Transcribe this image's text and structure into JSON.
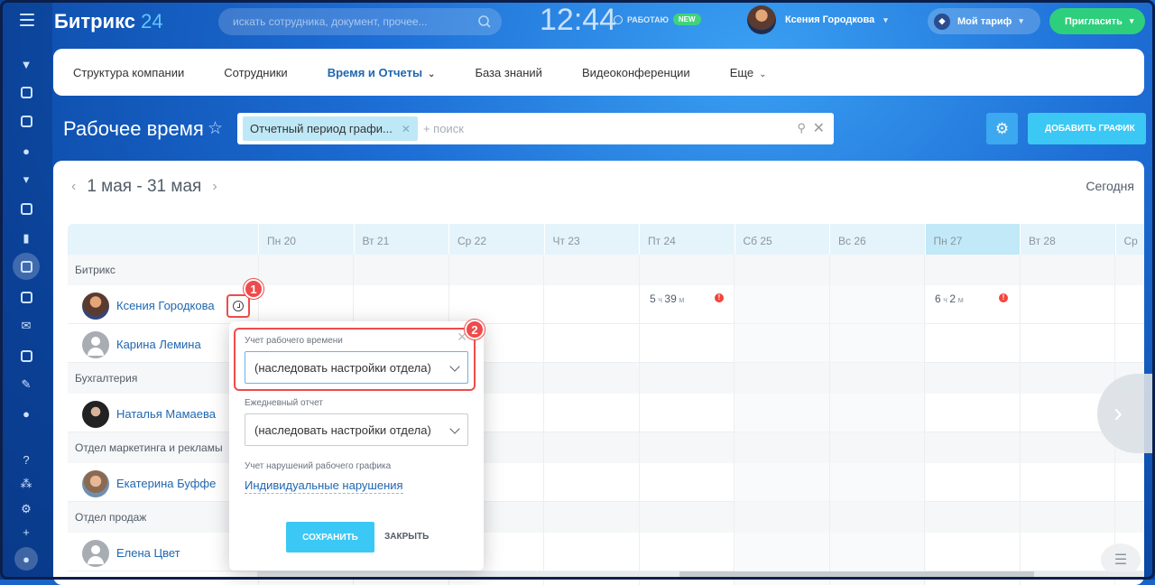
{
  "header": {
    "logo": "Битрикс",
    "logo_num": "24",
    "search_placeholder": "искать сотрудника, документ, прочее...",
    "time": "12:44",
    "work_status": "РАБОТАЮ",
    "work_badge": "NEW",
    "user_name": "Ксения Городкова",
    "tariff": "Мой тариф",
    "invite": "Пригласить"
  },
  "tabs": [
    "Структура компании",
    "Сотрудники",
    "Время и Отчеты",
    "База знаний",
    "Видеоконференции",
    "Еще"
  ],
  "page": {
    "title": "Рабочее время",
    "filter_chip": "Отчетный период графи...",
    "filter_placeholder": "+ поиск",
    "add_schedule": "ДОБАВИТЬ ГРАФИК",
    "period": "1 мая - 31 мая",
    "today": "Сегодня"
  },
  "days": [
    "Пн 20",
    "Вт 21",
    "Ср 22",
    "Чт 23",
    "Пт 24",
    "Сб 25",
    "Вс 26",
    "Пн 27",
    "Вт 28",
    "Ср"
  ],
  "groups": [
    {
      "name": "Битрикс"
    },
    {
      "name": "Бухгалтерия"
    },
    {
      "name": "Отдел маркетинга и рекламы"
    },
    {
      "name": "Отдел продаж"
    }
  ],
  "people": [
    "Ксения Городкова",
    "Карина Лемина",
    "Наталья Мамаева",
    "Екатерина Буффе",
    "Елена Цвет"
  ],
  "cells": {
    "fri_h": "5",
    "fri_h_unit": "ч",
    "fri_m": "39",
    "fri_m_unit": "м",
    "mon_h": "6",
    "mon_h_unit": "ч",
    "mon_m": "2",
    "mon_m_unit": "м"
  },
  "popup": {
    "label_tracking": "Учет рабочего времени",
    "value_tracking": "(наследовать настройки отдела)",
    "label_report": "Ежедневный отчет",
    "value_report": "(наследовать настройки отдела)",
    "label_violations": "Учет нарушений рабочего графика",
    "link_violations": "Индивидуальные нарушения",
    "save": "СОХРАНИТЬ",
    "close": "ЗАКРЫТЬ"
  },
  "markers": [
    "1",
    "2"
  ]
}
